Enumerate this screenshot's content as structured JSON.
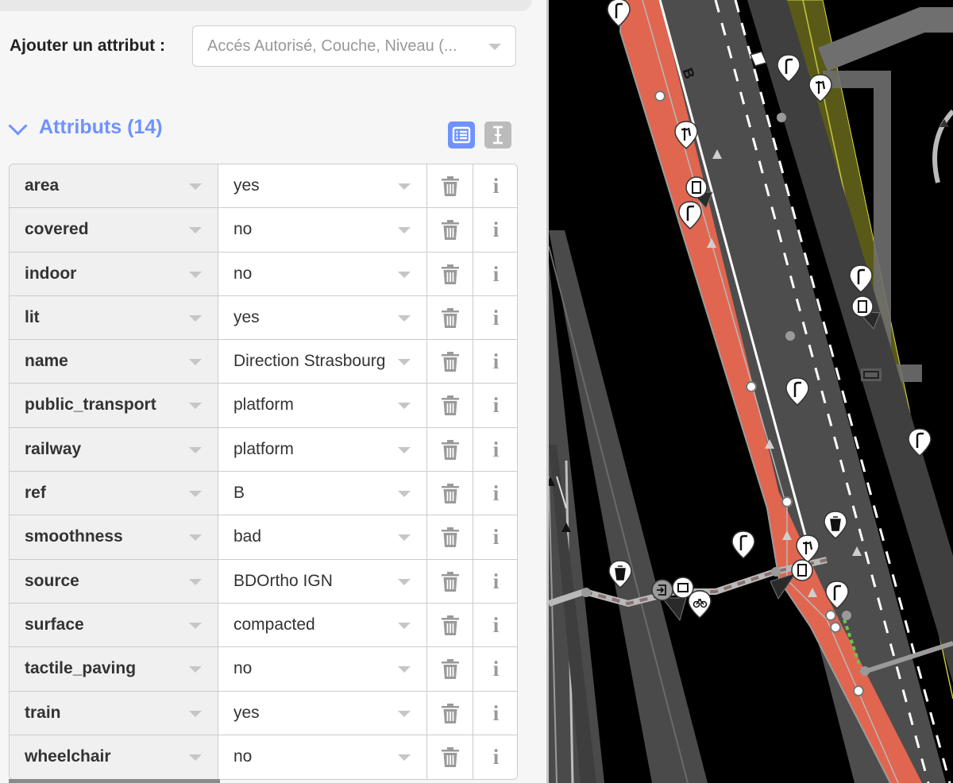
{
  "add_attribute": {
    "label": "Ajouter un attribut :",
    "placeholder": "Accés Autorisé, Couche, Niveau (..."
  },
  "section": {
    "title": "Attributs (14)"
  },
  "tags": [
    {
      "key": "area",
      "value": "yes"
    },
    {
      "key": "covered",
      "value": "no"
    },
    {
      "key": "indoor",
      "value": "no"
    },
    {
      "key": "lit",
      "value": "yes"
    },
    {
      "key": "name",
      "value": "Direction Strasbourg"
    },
    {
      "key": "public_transport",
      "value": "platform"
    },
    {
      "key": "railway",
      "value": "platform"
    },
    {
      "key": "ref",
      "value": "B"
    },
    {
      "key": "smoothness",
      "value": "bad"
    },
    {
      "key": "source",
      "value": "BDOrtho IGN"
    },
    {
      "key": "surface",
      "value": "compacted"
    },
    {
      "key": "tactile_paving",
      "value": "no"
    },
    {
      "key": "train",
      "value": "yes"
    },
    {
      "key": "wheelchair",
      "value": "no"
    }
  ],
  "row_actions": {
    "info_label": "i"
  },
  "map": {
    "route_label": "B",
    "colors": {
      "platform": "#e06650",
      "road": "#4d4d4d",
      "area": "#5a5a18"
    }
  },
  "colors": {
    "accent": "#7092ff",
    "view_inactive": "#bbbbbb"
  }
}
